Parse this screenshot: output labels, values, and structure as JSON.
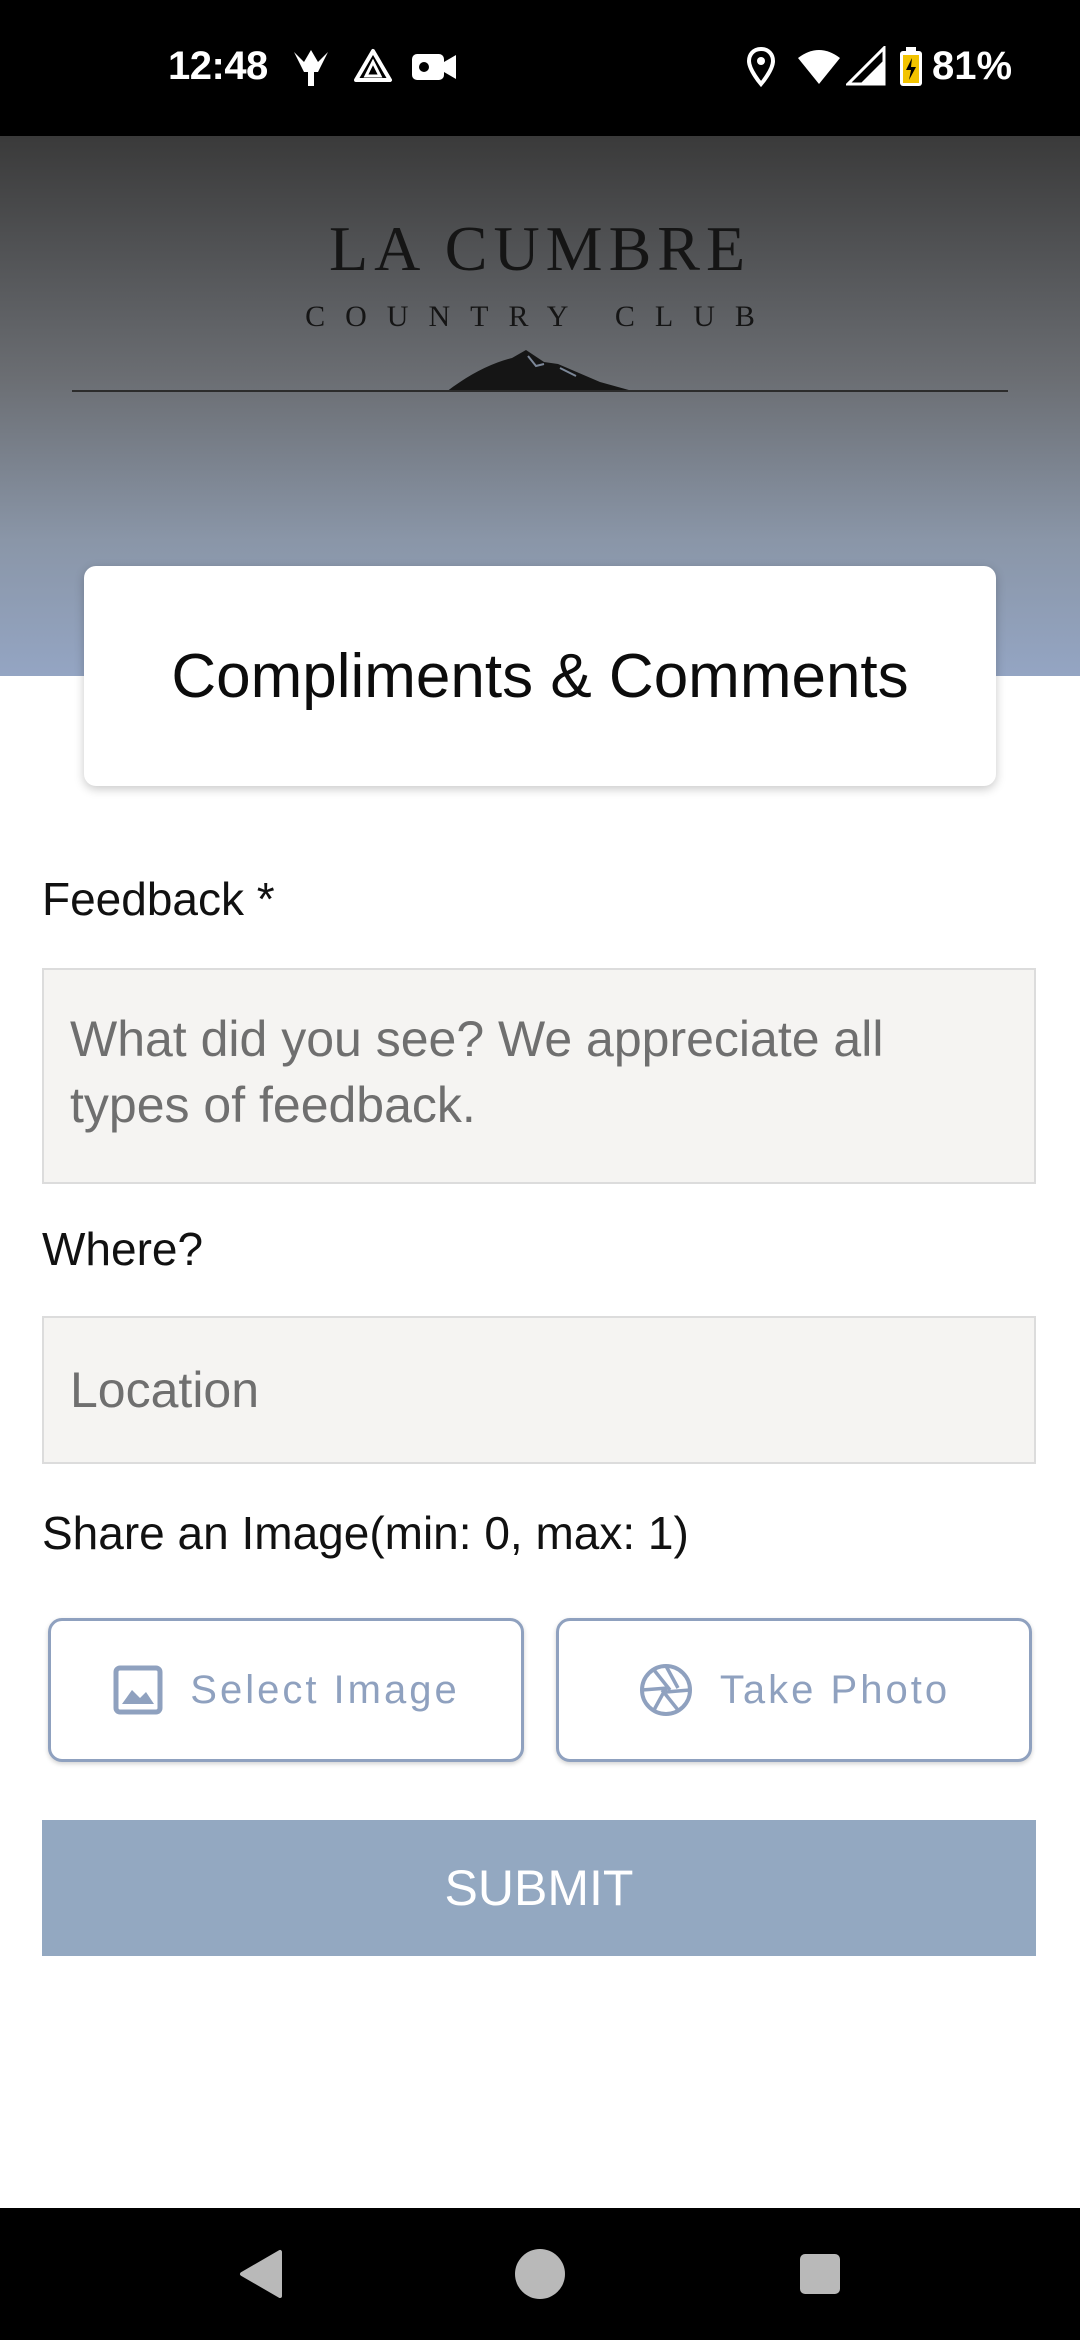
{
  "status_bar": {
    "time": "12:48",
    "battery_percent": "81%",
    "icons": [
      "notification-icon",
      "drive-icon",
      "video-icon",
      "location-icon",
      "wifi-icon",
      "signal-icon",
      "battery-icon"
    ]
  },
  "header": {
    "logo_title": "LA CUMBRE",
    "logo_subtitle": "COUNTRY CLUB",
    "page_title": "Compliments & Comments"
  },
  "form": {
    "feedback_label": "Feedback *",
    "feedback_placeholder": "What did you see? We appreciate all types of feedback.",
    "where_label": "Where?",
    "location_placeholder": "Location",
    "share_image_label": "Share an Image(min: 0, max: 1)",
    "select_image_label": "Select Image",
    "take_photo_label": "Take Photo",
    "submit_label": "SUBMIT"
  },
  "colors": {
    "accent": "#8fa1bf",
    "submit_bg": "#93a8c1",
    "field_bg": "#f5f4f2"
  },
  "nav_bar": {
    "icons": [
      "back-icon",
      "home-icon",
      "recents-icon"
    ]
  }
}
